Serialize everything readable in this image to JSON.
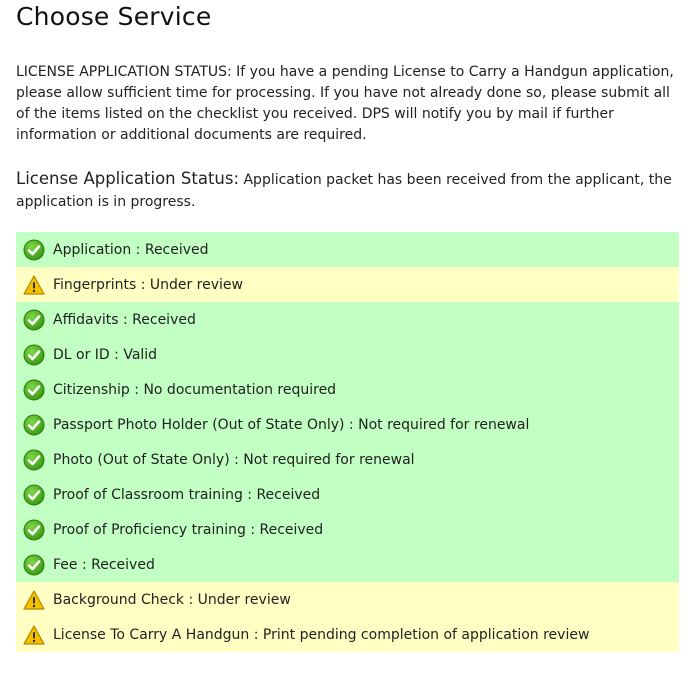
{
  "page": {
    "title": "Choose Service",
    "intro": "LICENSE APPLICATION STATUS: If you have a pending License to Carry a Handgun application, please allow sufficient time for processing. If you have not already done so, please submit all of the items listed on the checklist you received. DPS will notify you by mail if further information or additional documents are required.",
    "status_label": "License Application Status:",
    "status_text": "Application packet has been received from the applicant, the application is in progress."
  },
  "colors": {
    "ok_row": "#c2ffc2",
    "warn_row": "#ffffc4",
    "ok_icon": "#3a9a12",
    "warn_icon": "#f2c200"
  },
  "checklist": [
    {
      "status": "ok",
      "icon": "green-check-icon",
      "text": "Application : Received"
    },
    {
      "status": "warn",
      "icon": "warning-triangle-icon",
      "text": "Fingerprints : Under review"
    },
    {
      "status": "ok",
      "icon": "green-check-icon",
      "text": "Affidavits : Received"
    },
    {
      "status": "ok",
      "icon": "green-check-icon",
      "text": "DL or ID : Valid"
    },
    {
      "status": "ok",
      "icon": "green-check-icon",
      "text": "Citizenship : No documentation required"
    },
    {
      "status": "ok",
      "icon": "green-check-icon",
      "text": "Passport Photo Holder (Out of State Only) : Not required for renewal"
    },
    {
      "status": "ok",
      "icon": "green-check-icon",
      "text": "Photo (Out of State Only) : Not required for renewal"
    },
    {
      "status": "ok",
      "icon": "green-check-icon",
      "text": "Proof of Classroom training : Received"
    },
    {
      "status": "ok",
      "icon": "green-check-icon",
      "text": "Proof of Proficiency training : Received"
    },
    {
      "status": "ok",
      "icon": "green-check-icon",
      "text": "Fee : Received"
    },
    {
      "status": "warn",
      "icon": "warning-triangle-icon",
      "text": "Background Check : Under review"
    },
    {
      "status": "warn",
      "icon": "warning-triangle-icon",
      "text": "License To Carry A Handgun : Print pending completion of application review"
    }
  ]
}
